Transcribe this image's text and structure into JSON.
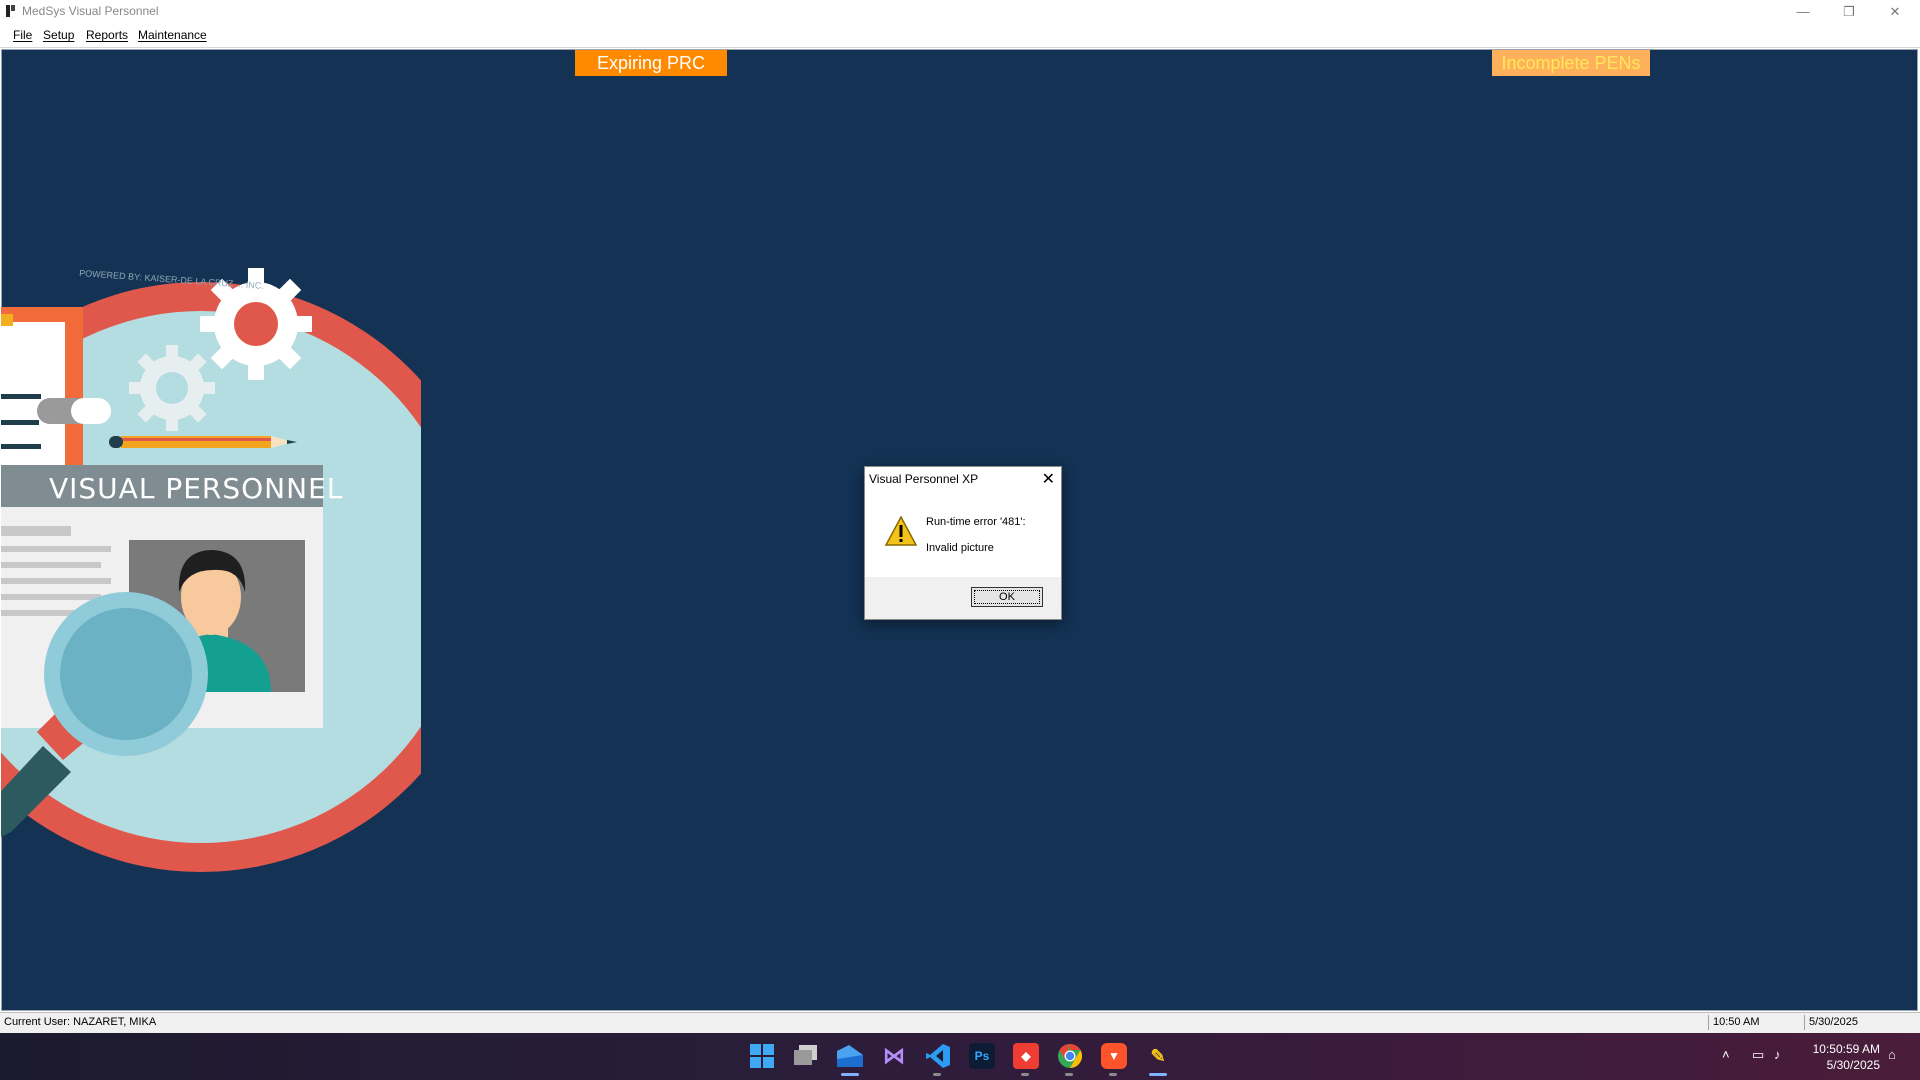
{
  "window": {
    "title": "MedSys Visual Personnel"
  },
  "menu": [
    "File",
    "Setup",
    "Reports",
    "Maintenance"
  ],
  "alerts": {
    "expiring_prc": "Expiring PRC",
    "incomplete_pens": "Incomplete PENs"
  },
  "splash": {
    "heading": "VISUAL PERSONNEL",
    "powered_by": "POWERED BY: KAISER-DE LA CRUZ ... INC."
  },
  "dialog": {
    "title": "Visual Personnel XP",
    "message_line1": "Run-time error '481':",
    "message_line2": "Invalid picture",
    "ok_label": "OK"
  },
  "statusbar": {
    "user": "Current User: NAZARET, MIKA",
    "time": "10:50 AM",
    "date": "5/30/2025"
  },
  "taskbar": {
    "clock_time": "10:50:59 AM",
    "clock_date": "5/30/2025",
    "apps": [
      "windows-start",
      "file-explorer",
      "app",
      "visual-studio",
      "vs-code",
      "photoshop",
      "anydesk",
      "chrome",
      "brave",
      "visual-personnel"
    ]
  },
  "colors": {
    "desktop_bg": "#133254",
    "alert_prc": "#ff8a00",
    "alert_pen_bg": "#ffb05a",
    "alert_pen_text": "#ffe85a",
    "dialog_bg": "#ffffff"
  }
}
